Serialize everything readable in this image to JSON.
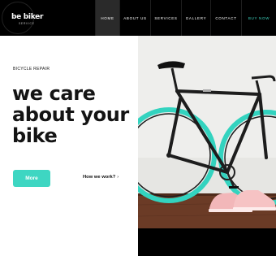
{
  "brand": {
    "logo_main": "be biker",
    "logo_sub": "SERVICE"
  },
  "nav": {
    "items": [
      {
        "label": "HOME",
        "active": true
      },
      {
        "label": "ABOUT US",
        "active": false
      },
      {
        "label": "SERVICES",
        "active": false
      },
      {
        "label": "GALLERY",
        "active": false
      },
      {
        "label": "CONTACT",
        "active": false
      },
      {
        "label": "BUY NOW",
        "active": false
      }
    ]
  },
  "hero": {
    "eyebrow": "BICYCLE REPAIR",
    "headline": [
      "we care",
      "about your",
      "bike"
    ],
    "primary_button": "More",
    "secondary_link": "How we work?",
    "secondary_chevron": "›"
  },
  "colors": {
    "accent": "#3ed6c2",
    "header_bg": "#000000",
    "text": "#141414"
  }
}
